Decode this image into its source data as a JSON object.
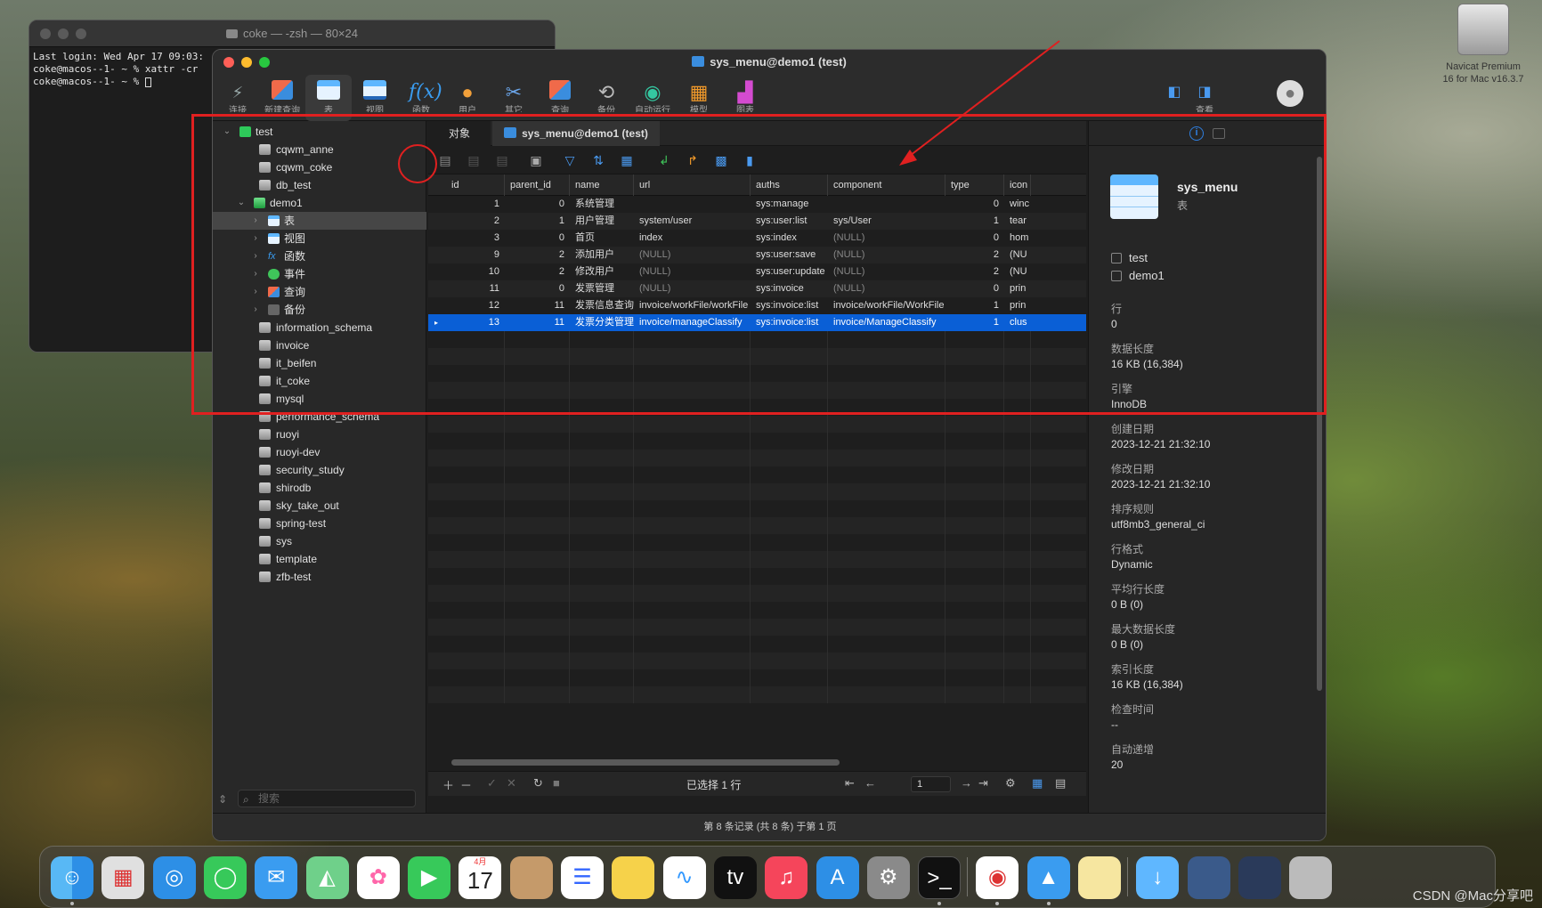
{
  "terminal": {
    "title": "coke — -zsh — 80×24",
    "lines": [
      "Last login: Wed Apr 17 09:03:",
      "coke@macos--1- ~ % xattr -cr",
      "coke@macos--1- ~ % "
    ]
  },
  "window": {
    "title": "sys_menu@demo1 (test)"
  },
  "toolbar": {
    "items": [
      {
        "label": "连接",
        "icon": "connection-icon"
      },
      {
        "label": "新建查询",
        "icon": "new-query-icon"
      },
      {
        "label": "表",
        "icon": "table-icon"
      },
      {
        "label": "视图",
        "icon": "view-icon"
      },
      {
        "label": "函数",
        "icon": "function-icon"
      },
      {
        "label": "用户",
        "icon": "user-icon"
      },
      {
        "label": "其它",
        "icon": "other-icon"
      },
      {
        "label": "查询",
        "icon": "query-icon"
      },
      {
        "label": "备份",
        "icon": "backup-icon"
      },
      {
        "label": "自动运行",
        "icon": "automation-icon"
      },
      {
        "label": "模型",
        "icon": "model-icon"
      },
      {
        "label": "图表",
        "icon": "chart-icon"
      }
    ],
    "view_label": "查看"
  },
  "sidebar": {
    "connection": "test",
    "databases_before": [
      "cqwm_anne",
      "cqwm_coke",
      "db_test"
    ],
    "open_db": "demo1",
    "open_db_children": [
      "表",
      "视图",
      "函数",
      "事件",
      "查询",
      "备份"
    ],
    "databases_after": [
      "information_schema",
      "invoice",
      "it_beifen",
      "it_coke",
      "mysql",
      "performance_schema",
      "ruoyi",
      "ruoyi-dev",
      "security_study",
      "shirodb",
      "sky_take_out",
      "spring-test",
      "sys",
      "template",
      "zfb-test"
    ],
    "search_placeholder": "搜索"
  },
  "tabs": {
    "objects": "对象",
    "current": "sys_menu@demo1 (test)"
  },
  "grid": {
    "columns": [
      "id",
      "parent_id",
      "name",
      "url",
      "auths",
      "component",
      "type",
      "icon"
    ],
    "rows": [
      [
        "1",
        "0",
        "系统管理",
        "",
        "sys:manage",
        "",
        "0",
        "winc"
      ],
      [
        "2",
        "1",
        "用户管理",
        "system/user",
        "sys:user:list",
        "sys/User",
        "1",
        "tear"
      ],
      [
        "3",
        "0",
        "首页",
        "index",
        "sys:index",
        "(NULL)",
        "0",
        "hom"
      ],
      [
        "9",
        "2",
        "添加用户",
        "(NULL)",
        "sys:user:save",
        "(NULL)",
        "2",
        "(NU"
      ],
      [
        "10",
        "2",
        "修改用户",
        "(NULL)",
        "sys:user:update",
        "(NULL)",
        "2",
        "(NU"
      ],
      [
        "11",
        "0",
        "发票管理",
        "(NULL)",
        "sys:invoice",
        "(NULL)",
        "0",
        "prin"
      ],
      [
        "12",
        "11",
        "发票信息查询",
        "invoice/workFile/workFile",
        "sys:invoice:list",
        "invoice/workFile/WorkFile",
        "1",
        "prin"
      ],
      [
        "13",
        "11",
        "发票分类管理",
        "invoice/manageClassify",
        "sys:invoice:list",
        "invoice/ManageClassify",
        "1",
        "clus"
      ]
    ],
    "selected_row": 7,
    "status": "已选择 1 行",
    "page": "1"
  },
  "footer": "第 8 条记录 (共 8 条) 于第 1 页",
  "info": {
    "name": "sys_menu",
    "type": "表",
    "connection": "test",
    "database": "demo1",
    "props": [
      {
        "k": "行",
        "v": "0"
      },
      {
        "k": "数据长度",
        "v": "16 KB (16,384)"
      },
      {
        "k": "引擎",
        "v": "InnoDB"
      },
      {
        "k": "创建日期",
        "v": "2023-12-21 21:32:10"
      },
      {
        "k": "修改日期",
        "v": "2023-12-21 21:32:10"
      },
      {
        "k": "排序规则",
        "v": "utf8mb3_general_ci"
      },
      {
        "k": "行格式",
        "v": "Dynamic"
      },
      {
        "k": "平均行长度",
        "v": "0 B (0)"
      },
      {
        "k": "最大数据长度",
        "v": "0 B (0)"
      },
      {
        "k": "索引长度",
        "v": "16 KB (16,384)"
      },
      {
        "k": "检查时间",
        "v": "--"
      },
      {
        "k": "自动递增",
        "v": "20"
      }
    ]
  },
  "desktop": {
    "navicat_label_1": "Navicat Premium",
    "navicat_label_2": "16 for Mac v16.3.7",
    "calendar_month": "4月",
    "calendar_day": "17",
    "watermark": "CSDN @Mac分享吧"
  },
  "dock": [
    "finder-icon",
    "launchpad-icon",
    "safari-icon",
    "messages-icon",
    "mail-icon",
    "maps-icon",
    "photos-icon",
    "facetime-icon",
    "calendar-icon",
    "contacts-icon",
    "reminders-icon",
    "notes-icon",
    "freeform-icon",
    "apple-tv-icon",
    "music-icon",
    "app-store-icon",
    "system-settings-icon",
    "terminal-icon",
    "chrome-icon",
    "navicat-icon",
    "navicat-data-modeler-icon",
    "downloads-folder-icon",
    "screenshot-icon",
    "screenshot-icon-2",
    "trash-icon"
  ],
  "colors": {
    "accent": "#0a5fd6",
    "highlight": "#e02020"
  }
}
